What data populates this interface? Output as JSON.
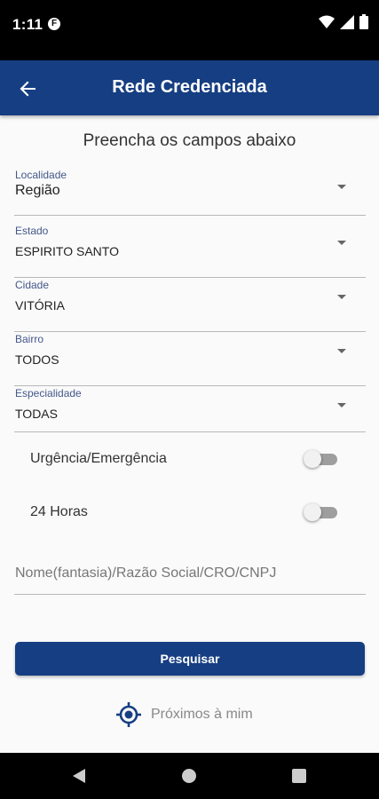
{
  "status_bar": {
    "time": "1:11",
    "app_icon_letter": "F"
  },
  "app_bar": {
    "title": "Rede Credenciada",
    "back_icon": "arrow-left-icon"
  },
  "form": {
    "heading": "Preencha os campos abaixo",
    "fields": [
      {
        "label": "Localidade",
        "value": "Região"
      },
      {
        "label": "Estado",
        "value": "ESPIRITO SANTO"
      },
      {
        "label": "Cidade",
        "value": "VITÓRIA"
      },
      {
        "label": "Bairro",
        "value": "TODOS"
      },
      {
        "label": "Especialidade",
        "value": "TODAS"
      }
    ],
    "toggles": [
      {
        "label": "Urgência/Emergência",
        "on": false
      },
      {
        "label": "24 Horas",
        "on": false
      }
    ],
    "search": {
      "placeholder": "Nome(fantasia)/Razão Social/CRO/CNPJ",
      "value": ""
    },
    "submit_label": "Pesquisar",
    "nearby": {
      "label": "Próximos à mim",
      "icon": "location-target-icon"
    }
  },
  "colors": {
    "primary": "#163e82",
    "label": "#44578a",
    "divider": "#b8b8b8"
  }
}
